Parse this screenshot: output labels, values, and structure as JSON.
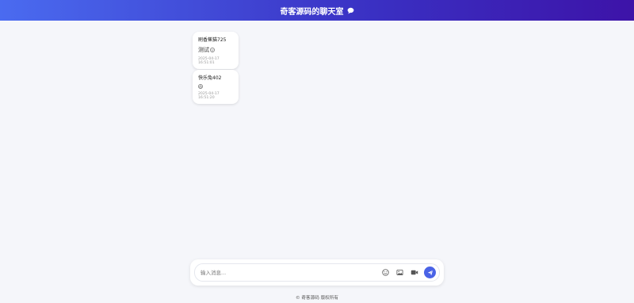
{
  "header": {
    "title": "奇客源码的聊天室",
    "icon": "speech-bubble-icon",
    "gradient": [
      "#4a6bf0",
      "#3d13a8"
    ]
  },
  "messages": [
    {
      "user": "刷香蕉猫725",
      "text": "测试",
      "emoji": "smile-emoji",
      "time": "2025-04-17 16:51:01"
    },
    {
      "user": "快乐兔402",
      "text": "",
      "emoji": "cake-emoji",
      "time": "2025-04-17 16:51:20"
    }
  ],
  "composer": {
    "placeholder": "输入消息...",
    "tools": [
      "emoji-icon",
      "image-icon",
      "video-icon"
    ],
    "send_icon": "send-icon",
    "accent": "#4a63e6"
  },
  "footer": {
    "text": "© 奇客源码 版权所有"
  }
}
